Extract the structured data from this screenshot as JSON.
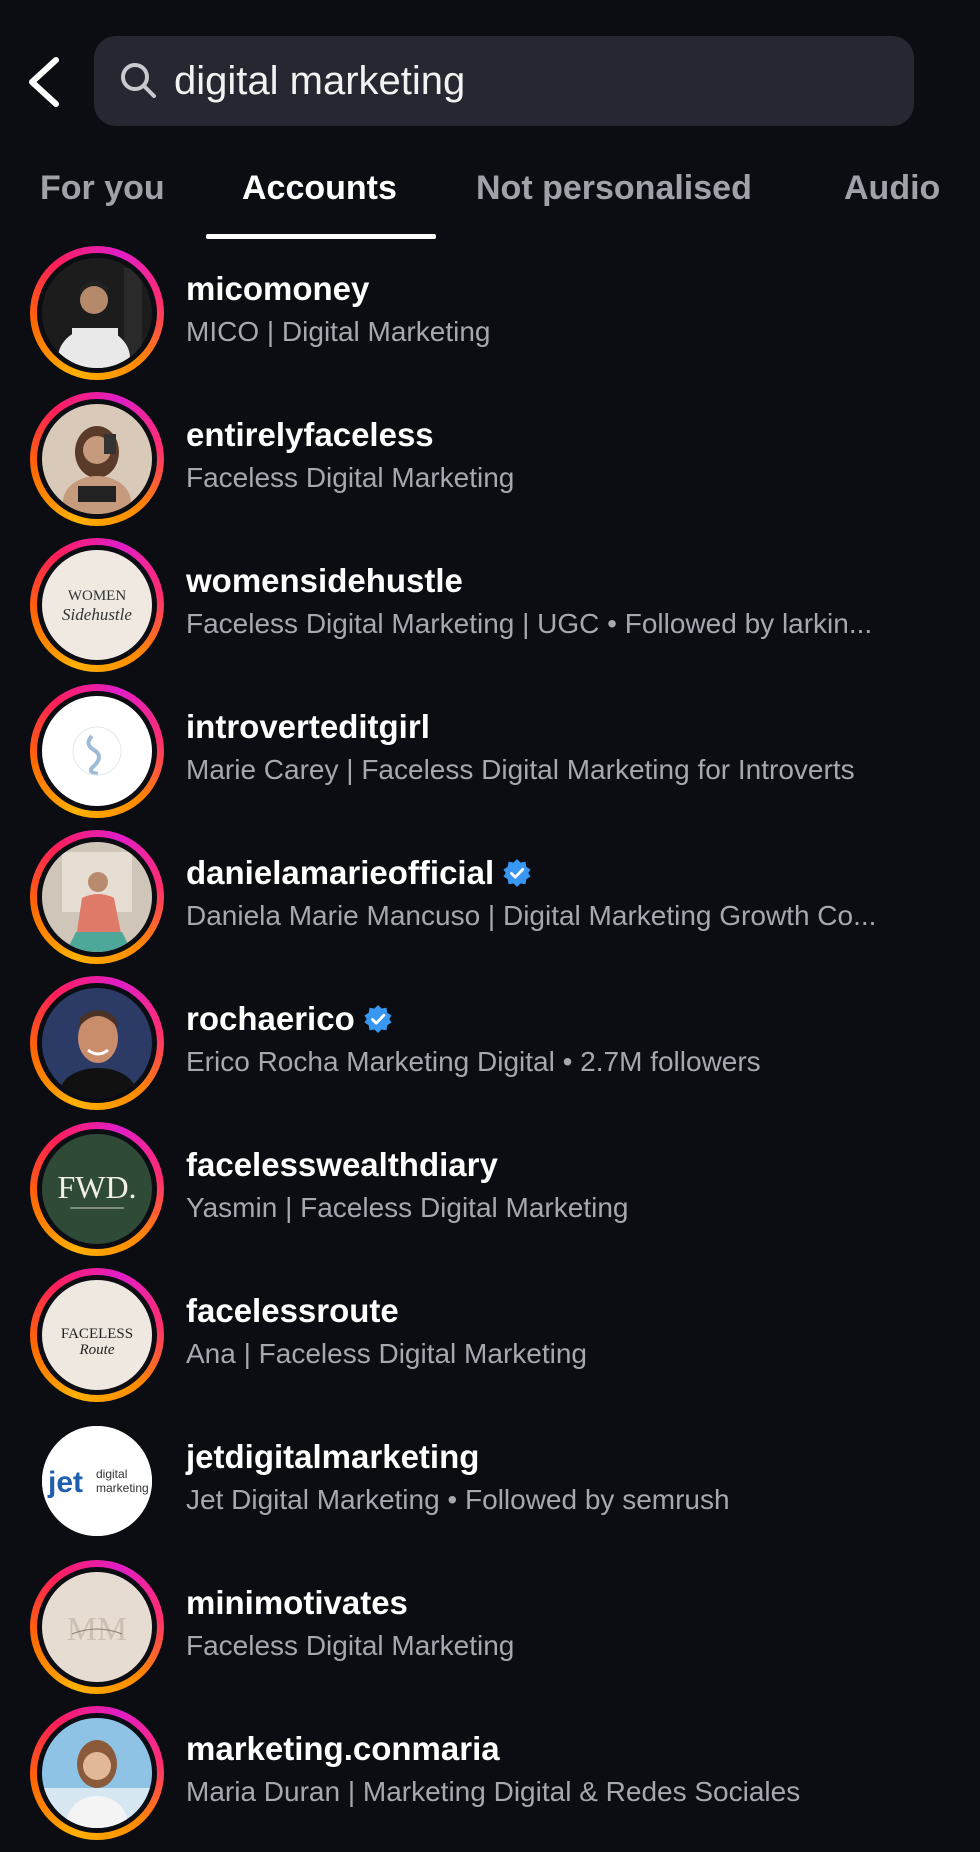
{
  "search": {
    "query": "digital marketing"
  },
  "tabs": [
    {
      "label": "For you"
    },
    {
      "label": "Accounts"
    },
    {
      "label": "Not personalised"
    },
    {
      "label": "Audio"
    }
  ],
  "accounts": [
    {
      "username": "micomoney",
      "subtitle": "MICO | Digital Marketing",
      "verified": false
    },
    {
      "username": "entirelyfaceless",
      "subtitle": "Faceless Digital Marketing",
      "verified": false
    },
    {
      "username": "womensidehustle",
      "subtitle": "Faceless Digital Marketing | UGC • Followed by larkin...",
      "verified": false,
      "avatar_text": [
        "WOMEN",
        "Sidehustle"
      ]
    },
    {
      "username": "introverteditgirl",
      "subtitle": "Marie Carey | Faceless Digital Marketing for Introverts",
      "verified": false
    },
    {
      "username": "danielamarieofficial",
      "subtitle": "Daniela Marie Mancuso | Digital Marketing Growth Co...",
      "verified": true
    },
    {
      "username": "rochaerico",
      "subtitle": "Erico Rocha Marketing Digital • 2.7M followers",
      "verified": true
    },
    {
      "username": "facelesswealthdiary",
      "subtitle": "Yasmin | Faceless Digital Marketing",
      "verified": false,
      "avatar_text": [
        "FWD."
      ]
    },
    {
      "username": "facelessroute",
      "subtitle": "Ana | Faceless Digital Marketing",
      "verified": false,
      "avatar_text": [
        "FACELESS",
        "Route"
      ]
    },
    {
      "username": "jetdigitalmarketing",
      "subtitle": "Jet Digital Marketing • Followed by semrush",
      "verified": false,
      "avatar_text": [
        "jet",
        "digital",
        "marketing"
      ]
    },
    {
      "username": "minimotivates",
      "subtitle": "Faceless Digital Marketing",
      "verified": false,
      "avatar_text": [
        "MM"
      ]
    },
    {
      "username": "marketing.conmaria",
      "subtitle": "Maria Duran | Marketing Digital & Redes Sociales",
      "verified": false
    }
  ],
  "colors": {
    "background": "#0b0d12",
    "search_bg": "#262730",
    "verified": "#3897f0",
    "subtitle": "#a6a8b0"
  }
}
